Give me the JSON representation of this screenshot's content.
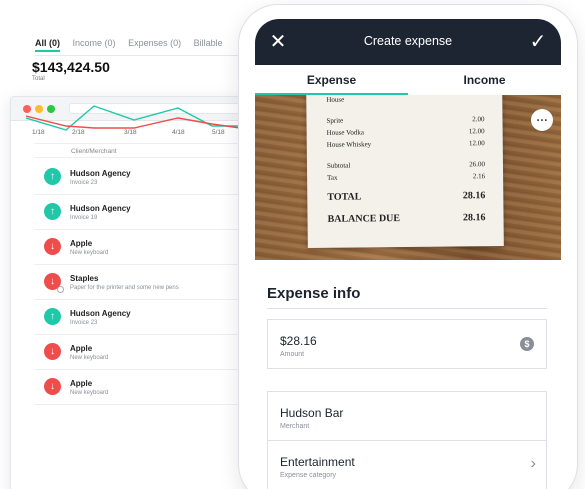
{
  "web": {
    "tabs": [
      "All (0)",
      "Income (0)",
      "Expenses (0)",
      "Billable"
    ],
    "total_amount": "$143,424.50",
    "total_label": "Total",
    "chart_ticks": [
      "1/18",
      "2/18",
      "3/18",
      "4/18",
      "5/18"
    ],
    "column_header": "Client/Merchant",
    "rows": [
      {
        "title": "Hudson Agency",
        "sub": "Invoice 23",
        "type": "in",
        "icon": "arrow-up-icon"
      },
      {
        "title": "Hudson Agency",
        "sub": "Invoice 19",
        "type": "in",
        "icon": "arrow-up-icon"
      },
      {
        "title": "Apple",
        "sub": "New keyboard",
        "type": "out",
        "icon": "arrow-down-icon"
      },
      {
        "title": "Staples",
        "sub": "Paper for the printer and some new pens",
        "type": "out",
        "icon": "arrow-down-icon"
      },
      {
        "title": "Hudson Agency",
        "sub": "Invoice 23",
        "type": "in",
        "icon": "arrow-up-icon"
      },
      {
        "title": "Apple",
        "sub": "New keyboard",
        "type": "out",
        "icon": "arrow-down-icon"
      },
      {
        "title": "Apple",
        "sub": "New keyboard",
        "type": "out",
        "icon": "arrow-down-icon"
      }
    ]
  },
  "colors": {
    "income": "#1ec8a8",
    "expense": "#ef4c4c",
    "header": "#1d2432"
  },
  "phone": {
    "title": "Create expense",
    "tabs": {
      "expense": "Expense",
      "income": "Income"
    },
    "receipt": {
      "top_fragment": "House",
      "items": [
        {
          "name": "Sprite",
          "value": "2.00"
        },
        {
          "name": "House Vodka",
          "value": "12.00"
        },
        {
          "name": "House Whiskey",
          "value": "12.00"
        },
        {
          "name": "Subtotal",
          "value": "26.00"
        },
        {
          "name": "Tax",
          "value": "2.16"
        }
      ],
      "total_label": "TOTAL",
      "total_value": "28.16",
      "balance_label": "BALANCE DUE",
      "balance_value": "28.16"
    },
    "section_title": "Expense info",
    "fields": [
      {
        "value": "$28.16",
        "label": "Amount"
      },
      {
        "value": "Hudson Bar",
        "label": "Merchant"
      },
      {
        "value": "Entertainment",
        "label": "Expense category"
      }
    ]
  }
}
